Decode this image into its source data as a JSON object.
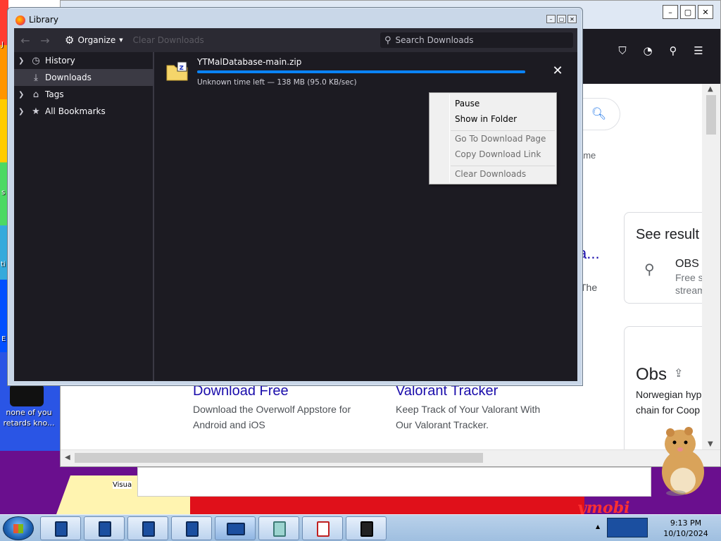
{
  "desktop": {
    "shortcut_label": "none of you retards kno...",
    "visual_label": "Visua",
    "wallpaper_text": "ymobi",
    "edge_letters": [
      "J",
      "s",
      "ti",
      "E"
    ]
  },
  "browser": {
    "window_controls": [
      "–",
      "▢",
      "✕"
    ],
    "search_icon": "search-icon",
    "partial_heading": "a...",
    "partial_text_the": "The",
    "partial_menu": "ame",
    "results": [
      {
        "title": "Download Free",
        "desc_line1": "Download the Overwolf Appstore for",
        "desc_line2": "Android and iOS"
      },
      {
        "title": "Valorant Tracker",
        "desc_line1": "Keep Track of Your Valorant With",
        "desc_line2": "Our Valorant Tracker."
      }
    ],
    "side_card": {
      "heading": "See result",
      "item_title": "OBS",
      "item_line1": "Free s",
      "item_line2": "stream"
    },
    "obs_card": {
      "title": "Obs",
      "line1": "Norwegian hype",
      "line2": "chain for Coop"
    }
  },
  "library": {
    "title": "Library",
    "toolbar": {
      "organize_label": "Organize",
      "clear_label": "Clear Downloads",
      "search_placeholder": "Search Downloads"
    },
    "sidebar": [
      {
        "label": "History",
        "icon": "clock-icon",
        "selected": false,
        "twisty": true
      },
      {
        "label": "Downloads",
        "icon": "download-icon",
        "selected": true,
        "twisty": false
      },
      {
        "label": "Tags",
        "icon": "tag-icon",
        "selected": false,
        "twisty": true
      },
      {
        "label": "All Bookmarks",
        "icon": "star-icon",
        "selected": false,
        "twisty": true
      }
    ],
    "download": {
      "filename": "YTMalDatabase-main.zip",
      "status": "Unknown time left — 138 MB (95.0 KB/sec)",
      "progress": 1.0
    }
  },
  "context_menu": {
    "items": [
      {
        "label": "Pause",
        "enabled": true
      },
      {
        "label": "Show in Folder",
        "enabled": true
      },
      {
        "label": "Go To Download Page",
        "enabled": false
      },
      {
        "label": "Copy Download Link",
        "enabled": false
      },
      {
        "label": "Clear Downloads",
        "enabled": false
      }
    ]
  },
  "taskbar": {
    "time": "9:13 PM",
    "date": "10/10/2024"
  }
}
